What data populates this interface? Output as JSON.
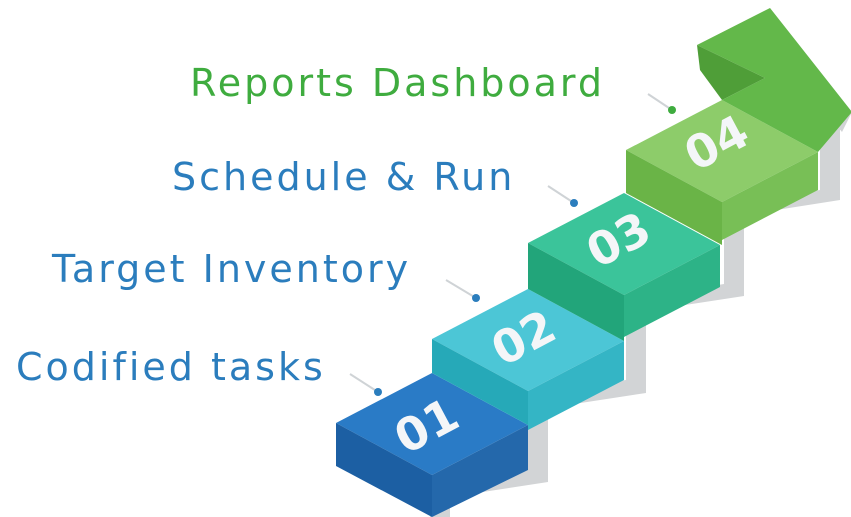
{
  "steps": [
    {
      "label": "Codified tasks",
      "number": "01",
      "label_color": "#2b7dbd"
    },
    {
      "label": "Target Inventory",
      "number": "02",
      "label_color": "#2b7dbd"
    },
    {
      "label": "Schedule & Run",
      "number": "03",
      "label_color": "#2b7dbd"
    },
    {
      "label": "Reports Dashboard",
      "number": "04",
      "label_color": "#3fac3f"
    }
  ],
  "colors": {
    "step1_top": "#2a7bc6",
    "step1_front": "#1c5fa3",
    "step2_top": "#4cc6d6",
    "step2_front": "#26a9b8",
    "step3_top": "#3bc49a",
    "step3_front": "#22a57a",
    "step4_top": "#8dcc6a",
    "step4_front": "#6ab447",
    "arrow": "#63b84a",
    "shadow": "#d2d4d6",
    "leader": "#cfd3d6",
    "dot": "#2b7dbd"
  }
}
